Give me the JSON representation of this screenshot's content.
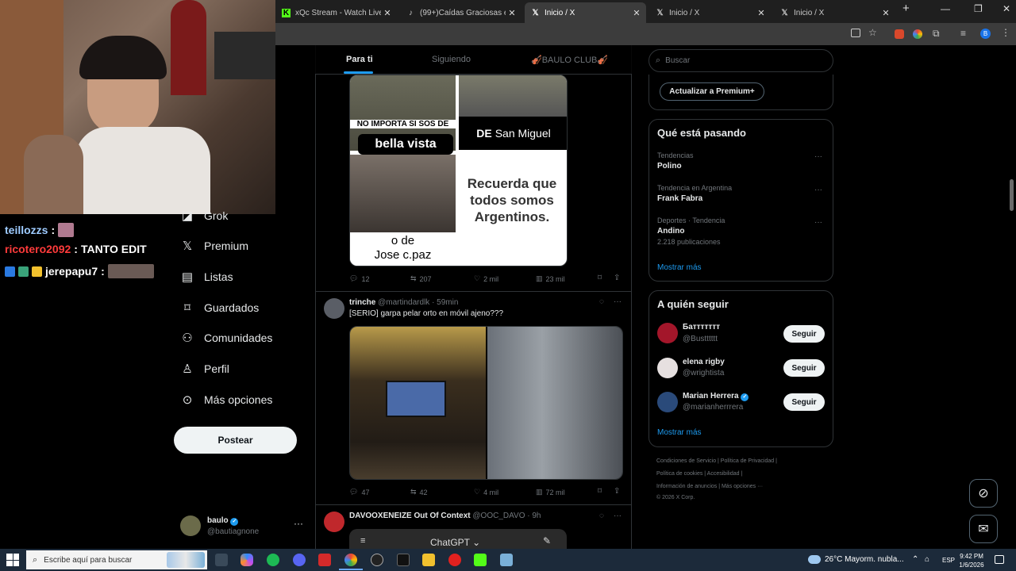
{
  "tabs": [
    {
      "label": "xQc Stream - Watch Live on Kick",
      "icon": "kick-icon"
    },
    {
      "label": "(99+)Caídas Graciosas en la Esc",
      "icon": "tiktok-icon"
    },
    {
      "label": "Inicio / X",
      "icon": "x-logo-icon"
    },
    {
      "label": "Inicio / X",
      "icon": "x-logo-icon"
    },
    {
      "label": "Inicio / X",
      "icon": "x-logo-icon"
    }
  ],
  "chat": [
    {
      "user": "teillozzs",
      "sep": " :",
      "msg": "",
      "color": "#9ecbff"
    },
    {
      "user": "ricotero2092",
      "sep": " :",
      "msg": " TANTO EDIT",
      "color": "#ff3b3b"
    },
    {
      "user": "jerepapu7",
      "sep": " :",
      "msg": "",
      "color": "#ffffff"
    }
  ],
  "nav": {
    "grok": "Grok",
    "premium": "Premium",
    "listas": "Listas",
    "guardados": "Guardados",
    "comunidades": "Comunidades",
    "perfil": "Perfil",
    "mas": "Más opciones",
    "postear": "Postear"
  },
  "account": {
    "name": "baulo",
    "handle": "@bautiagnone"
  },
  "timeline_tabs": [
    "Para ti",
    "Siguiendo",
    "🎻BAULO CLUB🎻"
  ],
  "tweet1": {
    "meme_text": {
      "t1": "NO IMPORTA SI SOS DE",
      "t2": "bella vista",
      "t3": "DE",
      "t4": "San Miguel",
      "t5": "Recuerda que todos somos Argentinos.",
      "t6": "o de",
      "t7": "Jose c.paz"
    },
    "replies": "12",
    "reposts": "207",
    "likes": "2 mil",
    "views": "23 mil"
  },
  "tweet2": {
    "name": "trinche",
    "handle": "@martindardlk",
    "time": "· 59min",
    "text": "[SERIO] garpa pelar orto en móvil ajeno???",
    "replies": "47",
    "reposts": "42",
    "likes": "4 mil",
    "views": "72 mil"
  },
  "tweet3": {
    "name": "DAVOOXENEIZE Out Of Context",
    "handle": "@OOC_DAVO",
    "time": "· 9h",
    "embed_title": "ChatGPT ⌄"
  },
  "search": {
    "placeholder": "Buscar"
  },
  "premium_button": "Actualizar a Premium+",
  "trends": {
    "title": "Qué está pasando",
    "items": [
      {
        "category": "Tendencias",
        "name": "Polino",
        "count": ""
      },
      {
        "category": "Tendencia en Argentina",
        "name": "Frank Fabra",
        "count": ""
      },
      {
        "category": "Deportes · Tendencia",
        "name": "Andino",
        "count": "2.218 publicaciones"
      }
    ],
    "more": "Mostrar más"
  },
  "who_to_follow": {
    "title": "A quién seguir",
    "items": [
      {
        "name": "Бaттттттт",
        "handle": "@Bustttttt",
        "button": "Seguir"
      },
      {
        "name": "elena rigby",
        "handle": "@wrightista",
        "button": "Seguir"
      },
      {
        "name": "Marian Herrera",
        "handle": "@marianherrrera",
        "button": "Seguir"
      }
    ],
    "more": "Mostrar más"
  },
  "footer": {
    "l1": "Condiciones de Servicio  |  Política de Privacidad  |",
    "l2": "Política de cookies  |  Accesibilidad  |",
    "l3": "Información de anuncios  |  Más opciones ···",
    "l4": "© 2026 X Corp."
  },
  "taskbar": {
    "search_placeholder": "Escribe aquí para buscar",
    "weather": "26°C  Mayorm. nubla...",
    "lang": "ESP",
    "time": "9:42 PM",
    "date": "1/6/2026"
  },
  "colors": {
    "verified": "#1d9bf0",
    "accent": "#1d9bf0",
    "bg": "#000000"
  }
}
